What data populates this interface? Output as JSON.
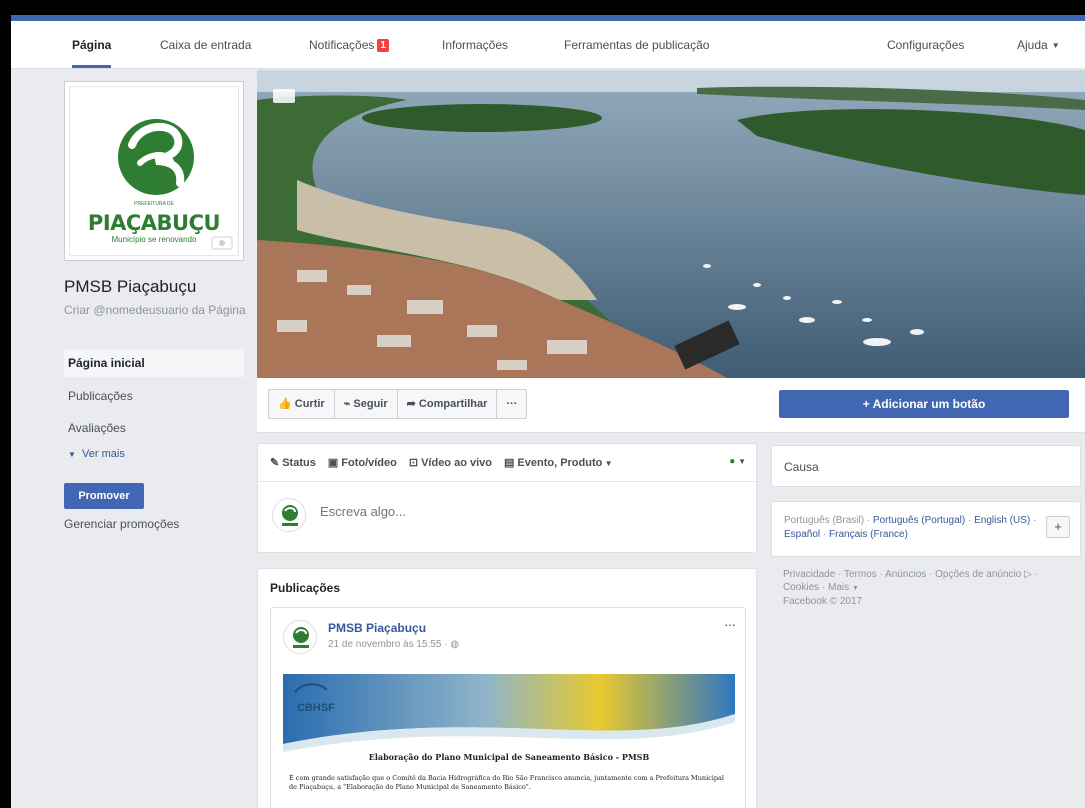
{
  "topnav": {
    "tabs": [
      {
        "label": "Página"
      },
      {
        "label": "Caixa de entrada"
      },
      {
        "label": "Notificações",
        "badge": "1"
      },
      {
        "label": "Informações"
      },
      {
        "label": "Ferramentas de publicação"
      }
    ],
    "settings": "Configurações",
    "help": "Ajuda"
  },
  "profile": {
    "logo_top": "PREFEITURA DE",
    "logo_name": "PIAÇABUÇU",
    "logo_tagline": "Município se renovando",
    "page_name": "PMSB Piaçabuçu",
    "username_prompt": "Criar @nomedeusuario da Página"
  },
  "left_nav": {
    "items": [
      {
        "label": "Página inicial"
      },
      {
        "label": "Publicações"
      },
      {
        "label": "Avaliações"
      }
    ],
    "more": "Ver mais",
    "promote": "Promover",
    "manage_promotions": "Gerenciar promoções"
  },
  "actions": {
    "like": "Curtir",
    "follow": "Seguir",
    "share": "Compartilhar",
    "more": "···",
    "add_button": "+ Adicionar um botão"
  },
  "composer": {
    "tabs": [
      {
        "label": "Status",
        "icon": "pencil-icon"
      },
      {
        "label": "Foto/vídeo",
        "icon": "photo-icon"
      },
      {
        "label": "Vídeo ao vivo",
        "icon": "live-video-icon"
      },
      {
        "label": "Evento, Produto",
        "icon": "calendar-icon"
      }
    ],
    "placeholder": "Escreva algo..."
  },
  "sidebar_right": {
    "cause": "Causa",
    "languages": {
      "current": "Português (Brasil)",
      "options": [
        "Português (Portugal)",
        "English (US)",
        "Español",
        "Français (France)"
      ]
    },
    "footer": {
      "links": [
        "Privacidade",
        "Termos",
        "Anúncios",
        "Opções de anúncio",
        "Cookies",
        "Mais"
      ],
      "copyright": "Facebook © 2017"
    }
  },
  "posts": {
    "title": "Publicações",
    "post": {
      "author": "PMSB Piaçabuçu",
      "time": "21 de novembro às 15:55",
      "menu": "···",
      "image": {
        "org": "CBHSF",
        "heading": "Elaboração do Plano Municipal de Saneamento Básico -  PMSB",
        "body": "É com grande satisfação que o Comitê da Bacia Hidrográfica do Rio São Francisco anuncia, juntamente com a Prefeitura  Municipal de Piaçabuçu, a \"Elaboração do Plano Municipal de Saneamento Básico\"."
      }
    }
  },
  "colors": {
    "facebook_blue": "#4267b2",
    "link_blue": "#365899",
    "page_bg": "#e9ebee",
    "logo_green": "#2e7d32",
    "badge_red": "#fa3e3e"
  }
}
